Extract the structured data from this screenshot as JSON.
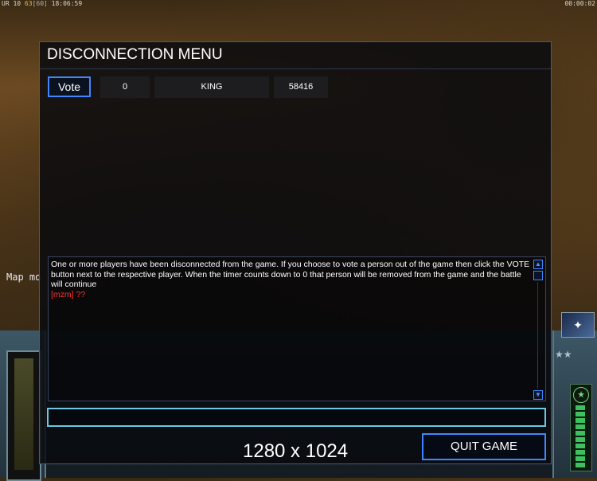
{
  "hud": {
    "top_left_prefix": "UR 10",
    "top_left_fps": "63",
    "top_left_fps_cap": "[60]",
    "top_left_time": "18:06:59",
    "top_right_timer": "00:00:02",
    "map_message": "Map mo"
  },
  "dialog": {
    "title": "DISCONNECTION MENU",
    "players": [
      {
        "vote_label": "Vote",
        "count": "0",
        "name": "KING",
        "ping": "58416"
      }
    ],
    "chat": {
      "system_message": "One or more players have been disconnected from the game. If you choose to vote a person out of the game then click the VOTE button next to the respective player. When the timer counts down to 0 that person will be removed from the game and the battle will continue",
      "user_message": "[mzm] ??"
    },
    "chat_input": {
      "value": "",
      "placeholder": ""
    },
    "quit_label": "QUIT GAME"
  },
  "resolution_label": "1280 x 1024",
  "colors": {
    "accent_blue": "#3f86ff",
    "input_border": "#6ec8e0",
    "chat_user": "#ff3030"
  }
}
